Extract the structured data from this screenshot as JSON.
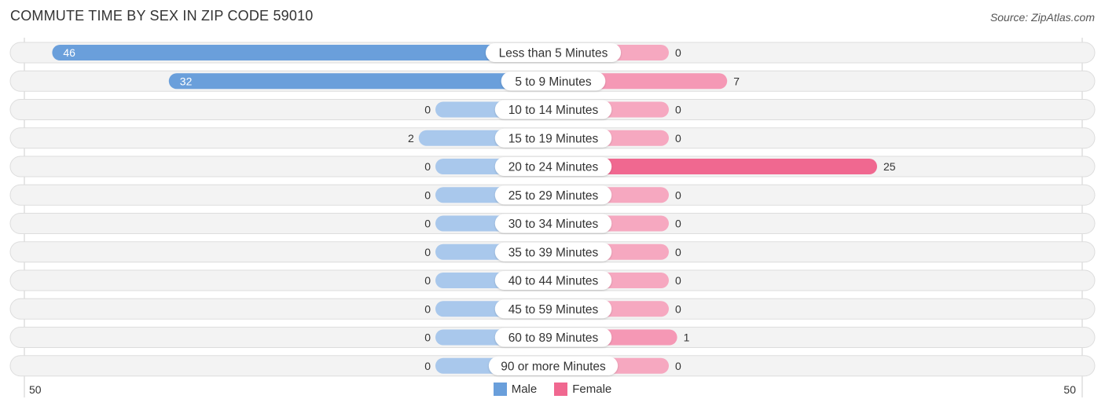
{
  "title": "COMMUTE TIME BY SEX IN ZIP CODE 59010",
  "source": "Source: ZipAtlas.com",
  "colors": {
    "male": "#6a9fdb",
    "male_light": "#a9c8ec",
    "female": "#f06890",
    "female_light": "#f6a8c0",
    "row_bg": "#f3f3f3",
    "row_border": "#dddddd"
  },
  "legend": [
    {
      "label": "Male",
      "color": "#6a9fdb"
    },
    {
      "label": "Female",
      "color": "#f06890"
    }
  ],
  "chart_data": {
    "type": "bar",
    "orientation": "horizontal-diverging",
    "title": "COMMUTE TIME BY SEX IN ZIP CODE 59010",
    "categories": [
      "Less than 5 Minutes",
      "5 to 9 Minutes",
      "10 to 14 Minutes",
      "15 to 19 Minutes",
      "20 to 24 Minutes",
      "25 to 29 Minutes",
      "30 to 34 Minutes",
      "35 to 39 Minutes",
      "40 to 44 Minutes",
      "45 to 59 Minutes",
      "60 to 89 Minutes",
      "90 or more Minutes"
    ],
    "series": [
      {
        "name": "Male",
        "values": [
          46,
          32,
          0,
          2,
          0,
          0,
          0,
          0,
          0,
          0,
          0,
          0
        ]
      },
      {
        "name": "Female",
        "values": [
          0,
          7,
          0,
          0,
          25,
          0,
          0,
          0,
          0,
          0,
          1,
          0
        ]
      }
    ],
    "axis": {
      "left_label": "50",
      "right_label": "50",
      "max": 50
    },
    "legend_position": "bottom-center"
  }
}
